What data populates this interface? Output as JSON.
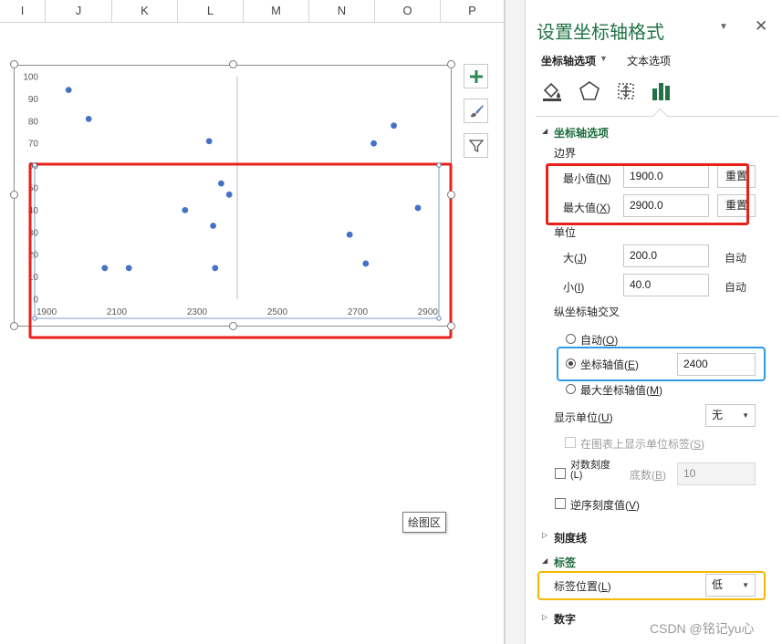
{
  "sheet": {
    "columns": [
      "I",
      "J",
      "K",
      "L",
      "M",
      "N",
      "O",
      "P"
    ],
    "tooltip": "绘图区"
  },
  "chart_data": {
    "type": "scatter",
    "xlim": [
      1900,
      2900
    ],
    "ylim": [
      0,
      100
    ],
    "x_ticks": [
      "1900",
      "2100",
      "2300",
      "2500",
      "2700",
      "2900"
    ],
    "y_ticks": [
      "0",
      "10",
      "20",
      "30",
      "40",
      "50",
      "60",
      "70",
      "80",
      "90",
      "100"
    ],
    "vertical_axis_crosses_at": 2400,
    "grid": false,
    "marker_color": "#4472c4",
    "series": [
      {
        "points": [
          [
            1980,
            94
          ],
          [
            2030,
            81
          ],
          [
            2070,
            14
          ],
          [
            2130,
            14
          ],
          [
            2270,
            40
          ],
          [
            2330,
            71
          ],
          [
            2340,
            33
          ],
          [
            2345,
            14
          ],
          [
            2360,
            52
          ],
          [
            2380,
            47
          ],
          [
            2680,
            29
          ],
          [
            2720,
            16
          ],
          [
            2740,
            70
          ],
          [
            2790,
            78
          ],
          [
            2850,
            41
          ]
        ]
      }
    ]
  },
  "chart_buttons": {
    "add": "plus-icon",
    "style": "brush-icon",
    "filter": "filter-icon"
  },
  "pane": {
    "title": "设置坐标轴格式",
    "close": "✕",
    "tab_axis": "坐标轴选项",
    "tab_text": "文本选项",
    "section_axis": "坐标轴选项",
    "bounds_label": "边界",
    "min_label": "最小值(",
    "min_key": "N",
    "min_value": "1900.0",
    "max_label": "最大值(",
    "max_key": "X",
    "max_value": "2900.0",
    "reset": "重置",
    "units_label": "单位",
    "major_label": "大(",
    "major_key": "J",
    "major_value": "200.0",
    "minor_label": "小(",
    "minor_key": "I",
    "minor_value": "40.0",
    "auto": "自动",
    "cross_label": "纵坐标轴交叉",
    "cross_auto": "自动(",
    "cross_auto_key": "O",
    "cross_value_label": "坐标轴值(",
    "cross_value_key": "E",
    "cross_value": "2400",
    "cross_max": "最大坐标轴值(",
    "cross_max_key": "M",
    "display_units": "显示单位(",
    "display_units_key": "U",
    "display_units_value": "无",
    "show_units_label": "在图表上显示单位标签(",
    "show_units_key": "S",
    "log_scale": "对数刻度",
    "log_scale_sub": "(L)",
    "base_label": "底数(",
    "base_key": "B",
    "base_value": "10",
    "reverse": "逆序刻度值(",
    "reverse_key": "V",
    "tick_marks": "刻度线",
    "labels": "标签",
    "label_pos": "标签位置(",
    "label_pos_key": "L",
    "label_pos_value": "低",
    "number": "数字",
    "watermark": "CSDN @铭记yu心"
  },
  "colors": {
    "accent_green": "#217346",
    "highlight_red": "#e8221b",
    "highlight_blue": "#2e9be8",
    "highlight_yellow": "#f5b800"
  }
}
